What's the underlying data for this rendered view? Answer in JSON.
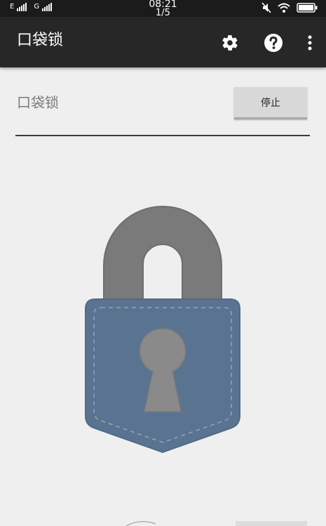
{
  "status_bar": {
    "left_labels": [
      "E",
      "G"
    ],
    "time": "08:21",
    "page_indicator": "1/5",
    "icons": [
      "signal-bars-icon",
      "mute-icon",
      "wifi-icon",
      "battery-icon"
    ]
  },
  "app_bar": {
    "title": "口袋锁",
    "actions": [
      "settings-gear-icon",
      "help-question-icon",
      "more-vertical-icon"
    ]
  },
  "service": {
    "label": "口袋锁",
    "stop_button_label": "停止"
  },
  "illustration": {
    "name": "pocket-lock-icon",
    "shackle_color": "#7a7a7a",
    "body_color": "#5a7391",
    "keyhole_color": "#8a8a8a",
    "stitch_color": "#8fa3b8"
  },
  "colors": {
    "status_bar_bg": "#1b1b1b",
    "app_bar_bg": "#272727",
    "page_bg": "#efefef",
    "button_bg": "#d8d8d8"
  }
}
